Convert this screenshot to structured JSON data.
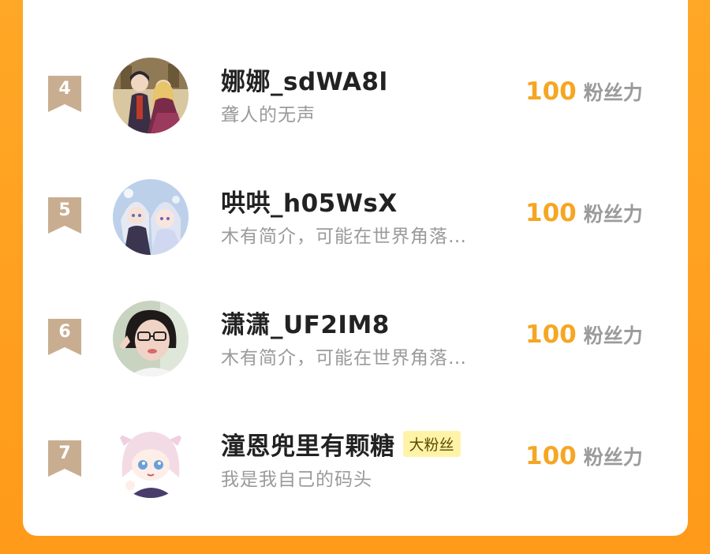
{
  "colors": {
    "background": "#ffa726",
    "card": "#ffffff",
    "score": "#f5a623",
    "rank_flag": "#c9ad90",
    "badge_bg": "#fff3a8"
  },
  "ranking": [
    {
      "rank": "4",
      "name": "娜娜_sdWA8l",
      "badge": "",
      "bio": "聋人的无声",
      "score": "100",
      "unit": "粉丝力",
      "avatar": "avatar-anime-couple"
    },
    {
      "rank": "5",
      "name": "哄哄_h05WsX",
      "badge": "",
      "bio": "木有简介，可能在世界角落…",
      "score": "100",
      "unit": "粉丝力",
      "avatar": "avatar-anime-silver-hair"
    },
    {
      "rank": "6",
      "name": "潇潇_UF2IM8",
      "badge": "",
      "bio": "木有简介，可能在世界角落…",
      "score": "100",
      "unit": "粉丝力",
      "avatar": "avatar-photo-girl-glasses"
    },
    {
      "rank": "7",
      "name": "潼恩兜里有颗糖",
      "badge": "大粉丝",
      "bio": "我是我自己的码头",
      "score": "100",
      "unit": "粉丝力",
      "avatar": "avatar-chibi-pink-hair"
    }
  ]
}
